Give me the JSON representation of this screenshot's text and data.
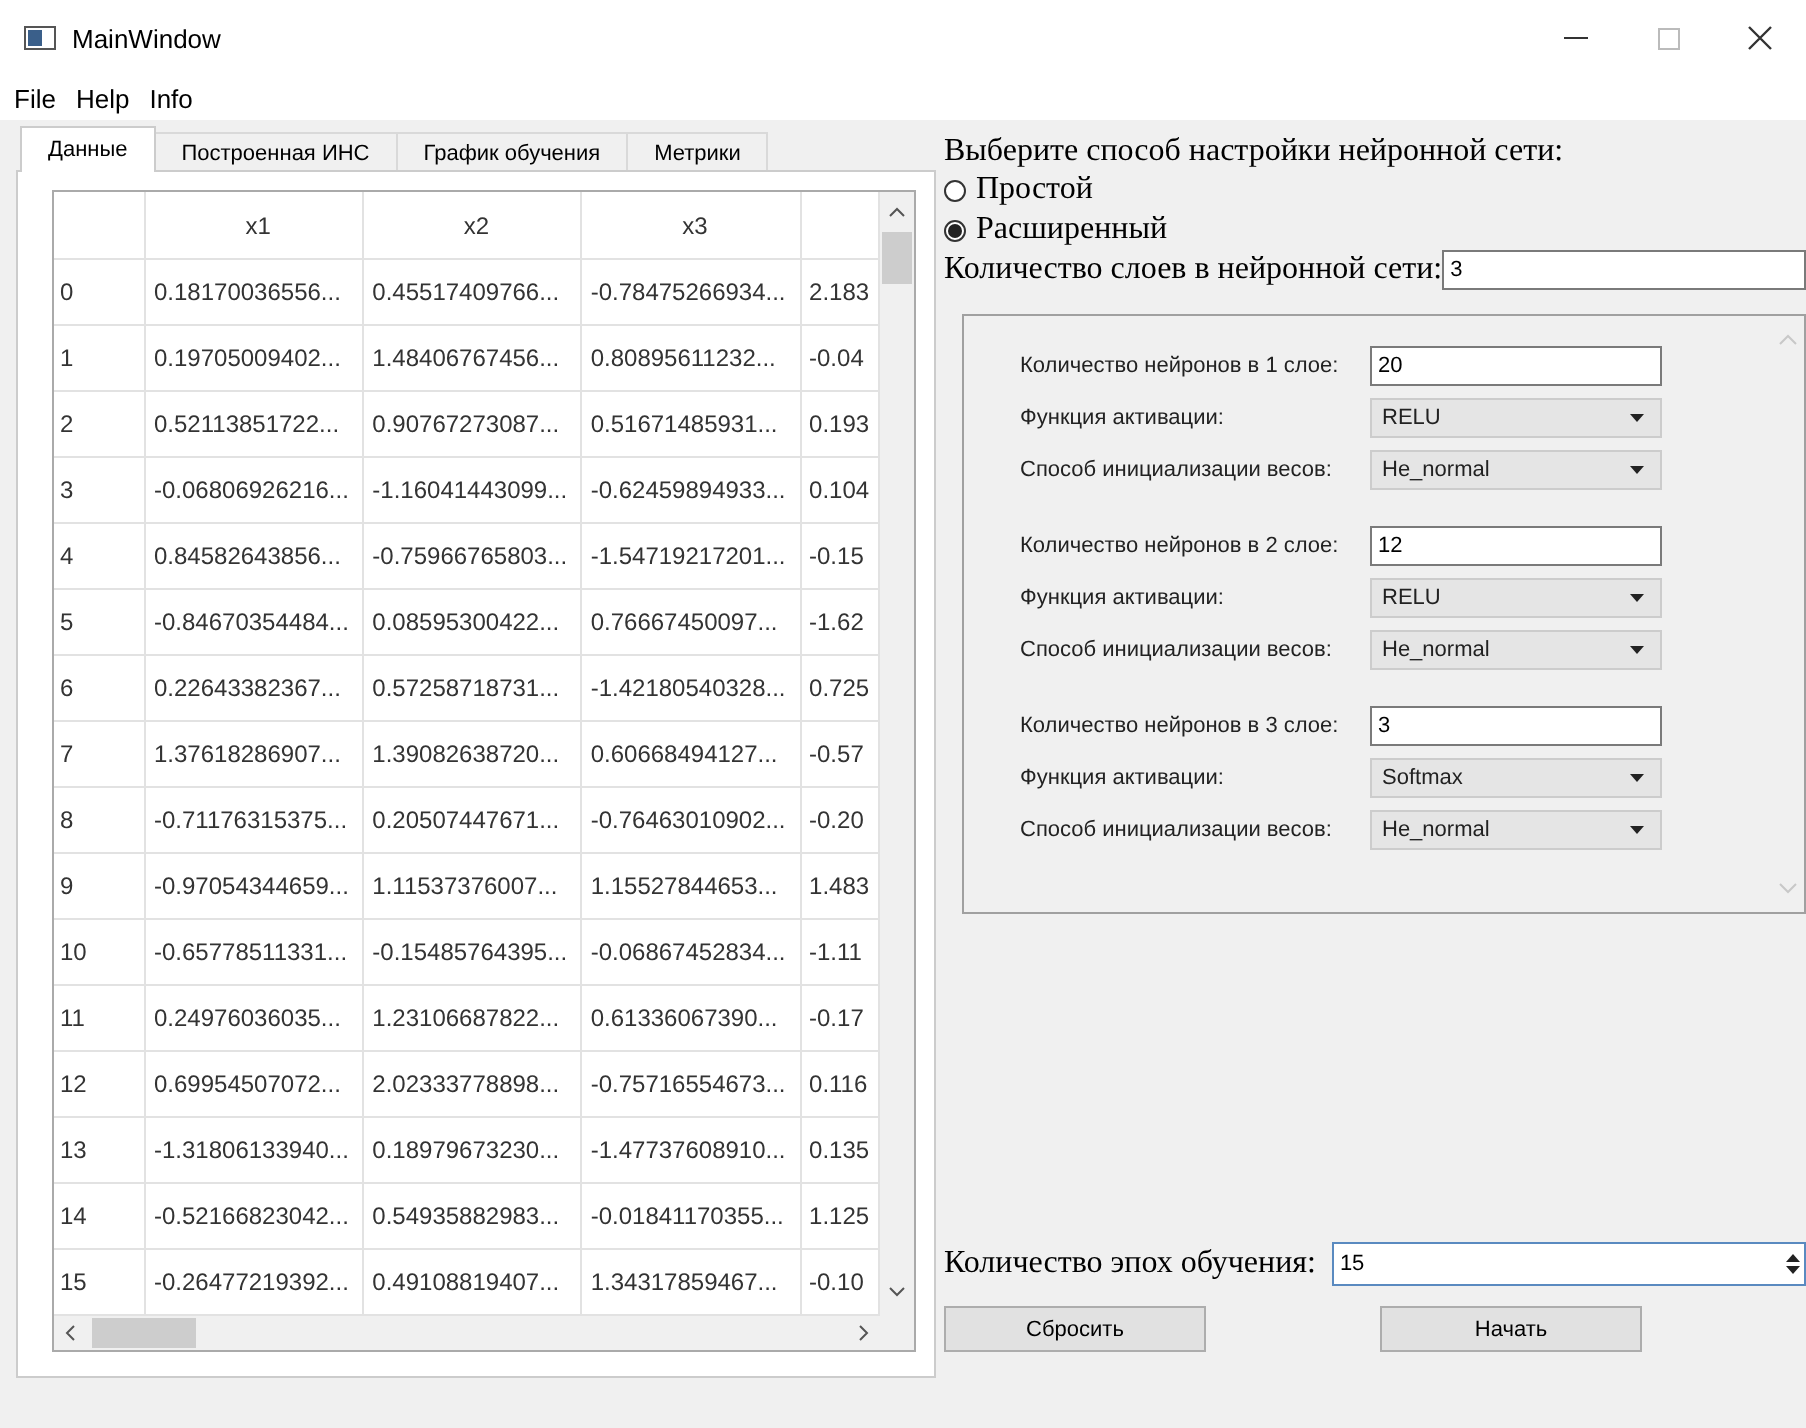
{
  "window": {
    "title": "MainWindow"
  },
  "menu": [
    "File",
    "Help",
    "Info"
  ],
  "tabs": [
    {
      "label": "Данные",
      "selected": true
    },
    {
      "label": "Построенная ИНС",
      "selected": false
    },
    {
      "label": "График обучения",
      "selected": false
    },
    {
      "label": "Метрики",
      "selected": false
    }
  ],
  "table": {
    "columns": [
      "x1",
      "x2",
      "x3"
    ],
    "rows": [
      {
        "index": "0",
        "cells": [
          "0.18170036556...",
          "0.45517409766...",
          "-0.78475266934...",
          "2.183"
        ]
      },
      {
        "index": "1",
        "cells": [
          "0.19705009402...",
          "1.48406767456...",
          "0.80895611232...",
          "-0.04"
        ]
      },
      {
        "index": "2",
        "cells": [
          "0.52113851722...",
          "0.90767273087...",
          "0.51671485931...",
          "0.193"
        ]
      },
      {
        "index": "3",
        "cells": [
          "-0.06806926216...",
          "-1.16041443099...",
          "-0.62459894933...",
          "0.104"
        ]
      },
      {
        "index": "4",
        "cells": [
          "0.84582643856...",
          "-0.75966765803...",
          "-1.54719217201...",
          "-0.15"
        ]
      },
      {
        "index": "5",
        "cells": [
          "-0.84670354484...",
          "0.08595300422...",
          "0.76667450097...",
          "-1.62"
        ]
      },
      {
        "index": "6",
        "cells": [
          "0.22643382367...",
          "0.57258718731...",
          "-1.42180540328...",
          "0.725"
        ]
      },
      {
        "index": "7",
        "cells": [
          "1.37618286907...",
          "1.39082638720...",
          "0.60668494127...",
          "-0.57"
        ]
      },
      {
        "index": "8",
        "cells": [
          "-0.71176315375...",
          "0.20507447671...",
          "-0.76463010902...",
          "-0.20"
        ]
      },
      {
        "index": "9",
        "cells": [
          "-0.97054344659...",
          "1.11537376007...",
          "1.15527844653...",
          "1.483"
        ]
      },
      {
        "index": "10",
        "cells": [
          "-0.65778511331...",
          "-0.15485764395...",
          "-0.06867452834...",
          "-1.11"
        ]
      },
      {
        "index": "11",
        "cells": [
          "0.24976036035...",
          "1.23106687822...",
          "0.61336067390...",
          "-0.17"
        ]
      },
      {
        "index": "12",
        "cells": [
          "0.69954507072...",
          "2.02333778898...",
          "-0.75716554673...",
          "0.116"
        ]
      },
      {
        "index": "13",
        "cells": [
          "-1.31806133940...",
          "0.18979673230...",
          "-1.47737608910...",
          "0.135"
        ]
      },
      {
        "index": "14",
        "cells": [
          "-0.52166823042...",
          "0.54935882983...",
          "-0.01841170355...",
          "1.125"
        ]
      },
      {
        "index": "15",
        "cells": [
          "-0.26477219392...",
          "0.49108819407...",
          "1.34317859467...",
          "-0.10"
        ]
      }
    ]
  },
  "settings": {
    "heading": "Выберите способ настройки нейронной сети:",
    "modes": [
      {
        "label": "Простой",
        "selected": false
      },
      {
        "label": "Расширенный",
        "selected": true
      }
    ],
    "layers_count": {
      "label": "Количество слоев в нейронной сети:",
      "value": "3"
    },
    "layers": [
      {
        "neurons_label": "Количество нейронов в 1 слое:",
        "neurons": "20",
        "activation_label": "Функция активации:",
        "activation": "RELU",
        "init_label": "Способ инициализации весов:",
        "init": "He_normal"
      },
      {
        "neurons_label": "Количество нейронов в 2 слое:",
        "neurons": "12",
        "activation_label": "Функция активации:",
        "activation": "RELU",
        "init_label": "Способ инициализации весов:",
        "init": "He_normal"
      },
      {
        "neurons_label": "Количество нейронов в 3 слое:",
        "neurons": "3",
        "activation_label": "Функция активации:",
        "activation": "Softmax",
        "init_label": "Способ инициализации весов:",
        "init": "He_normal"
      }
    ],
    "epochs": {
      "label": "Количество эпох обучения:",
      "value": "15"
    },
    "buttons": [
      "Сбросить",
      "Начать"
    ]
  }
}
